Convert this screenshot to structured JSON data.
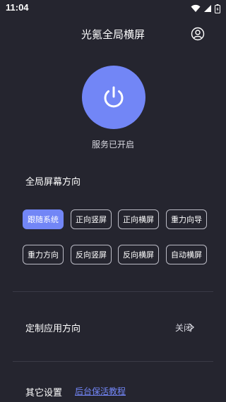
{
  "status_bar": {
    "time": "11:04",
    "icons": [
      "wifi-icon",
      "signal-icon",
      "battery-icon"
    ]
  },
  "header": {
    "title": "光氪全局横屏",
    "account_icon": "account-icon"
  },
  "power": {
    "icon": "power-icon",
    "status_text": "服务已开启"
  },
  "global_orientation": {
    "title": "全局屏幕方向",
    "options": [
      {
        "label": "跟随系统",
        "selected": true
      },
      {
        "label": "正向竖屏",
        "selected": false
      },
      {
        "label": "正向横屏",
        "selected": false
      },
      {
        "label": "重力向导",
        "selected": false
      },
      {
        "label": "重力方向",
        "selected": false
      },
      {
        "label": "反向竖屏",
        "selected": false
      },
      {
        "label": "反向横屏",
        "selected": false
      },
      {
        "label": "自动横屏",
        "selected": false
      }
    ]
  },
  "custom_app": {
    "title": "定制应用方向",
    "value": "关闭"
  },
  "other_settings": {
    "title": "其它设置",
    "link": "后台保活教程"
  },
  "colors": {
    "background": "#25252f",
    "accent": "#7286f6",
    "chip_border": "#bcbcc6"
  }
}
